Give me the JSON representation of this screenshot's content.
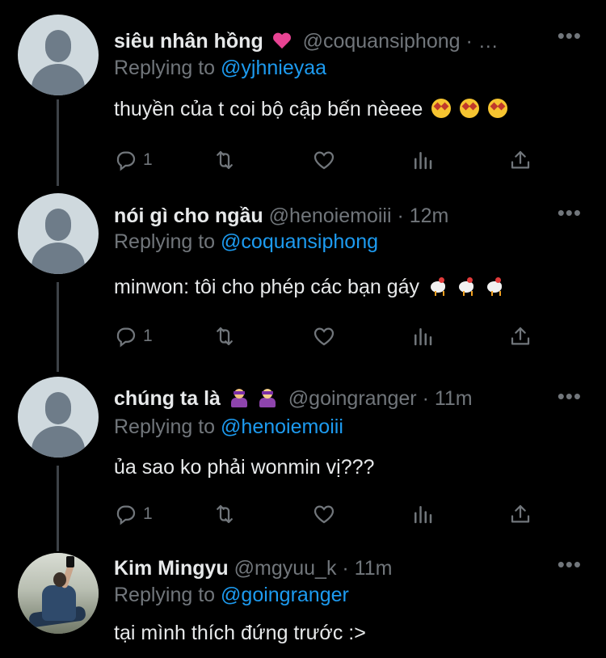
{
  "theme": {
    "background": "#000000",
    "text": "#e7e9ea",
    "muted": "#71767b",
    "link": "#1d9bf0",
    "thread_line": "#3d4247"
  },
  "tweets": [
    {
      "name": "siêu nhân hồng",
      "name_emoji": "pink-heart-emoji",
      "handle": "@coquansiphong",
      "time": "· …",
      "replying_label": "Replying to",
      "replying_to": "@yjhnieyaa",
      "text": "thuyền của t coi bộ cập bến nèeee",
      "text_emojis": [
        "star-struck-emoji",
        "star-struck-emoji",
        "star-struck-emoji"
      ],
      "replies": "1",
      "avatar": "default-avatar"
    },
    {
      "name": "nói gì cho ngầu",
      "handle": "@henoiemoiii",
      "time": "· 12m",
      "replying_label": "Replying to",
      "replying_to": "@coquansiphong",
      "text": "minwon: tôi cho phép các bạn gáy",
      "text_emojis": [
        "rooster-emoji",
        "rooster-emoji",
        "rooster-emoji"
      ],
      "replies": "1",
      "avatar": "default-avatar"
    },
    {
      "name": "chúng ta là",
      "name_emoji": "superhero-emojis",
      "handle": "@goingranger",
      "time": "· 11m",
      "replying_label": "Replying to",
      "replying_to": "@henoiemoiii",
      "text": "ủa sao ko phải wonmin vị???",
      "replies": "1",
      "avatar": "default-avatar"
    },
    {
      "name": "Kim Mingyu",
      "handle": "@mgyuu_k",
      "time": "· 11m",
      "replying_label": "Replying to",
      "replying_to": "@goingranger",
      "text": "tại mình thích đứng trước :>",
      "avatar": "photo-avatar"
    }
  ],
  "more_label": "•••",
  "icons": [
    "reply-icon",
    "retweet-icon",
    "like-icon",
    "analytics-icon",
    "share-icon",
    "more-icon"
  ]
}
